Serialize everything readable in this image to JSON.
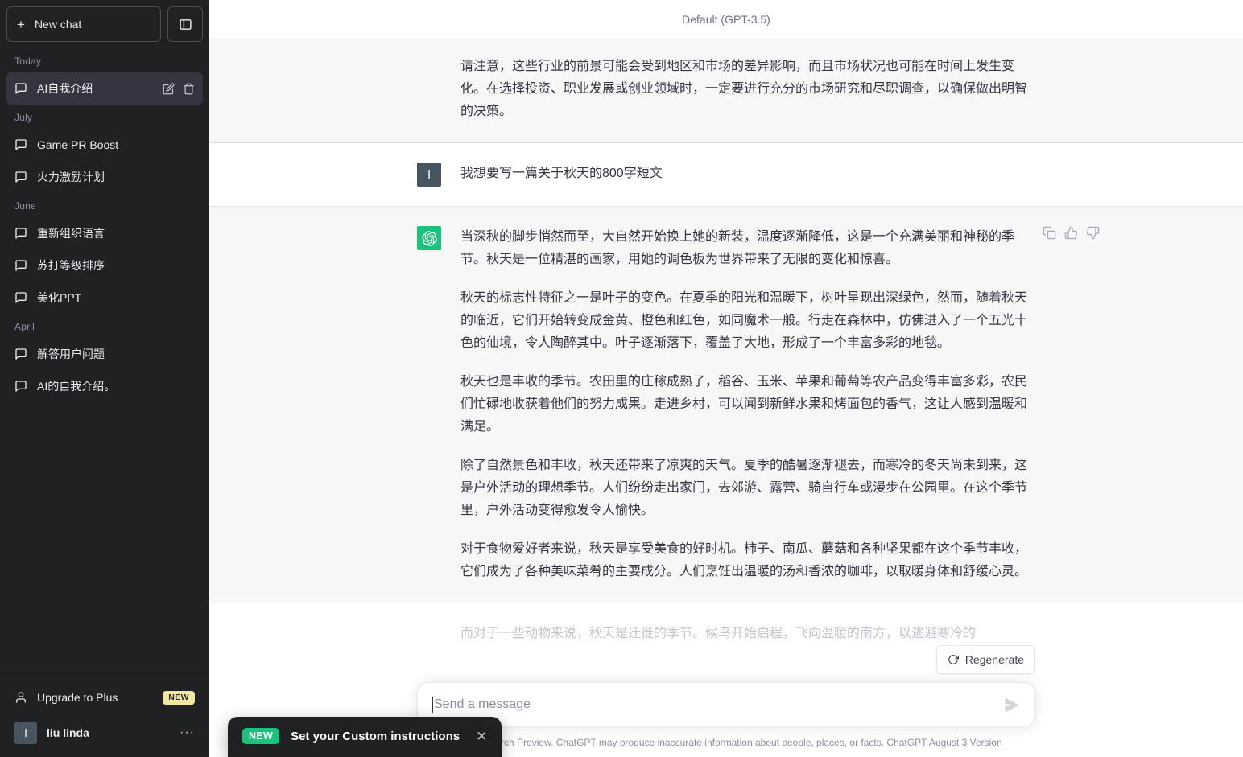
{
  "sidebar": {
    "new_chat_label": "New chat",
    "groups": [
      {
        "label": "Today",
        "items": [
          {
            "title": "AI自我介绍",
            "active": true
          }
        ]
      },
      {
        "label": "July",
        "items": [
          {
            "title": "Game PR Boost",
            "active": false
          },
          {
            "title": "火力激励计划",
            "active": false
          }
        ]
      },
      {
        "label": "June",
        "items": [
          {
            "title": "重新组织语言",
            "active": false
          },
          {
            "title": "苏打等级排序",
            "active": false
          },
          {
            "title": "美化PPT",
            "active": false
          }
        ]
      },
      {
        "label": "April",
        "items": [
          {
            "title": "解答用户问题",
            "active": false
          },
          {
            "title": "AI的自我介绍。",
            "active": false
          }
        ]
      }
    ],
    "upgrade_label": "Upgrade to Plus",
    "upgrade_badge": "NEW",
    "user_name": "liu linda",
    "user_initial": "l",
    "more_dots": "···"
  },
  "header": {
    "model": "Default (GPT-3.5)"
  },
  "messages": [
    {
      "role": "assistant",
      "paragraphs": [
        "请注意，这些行业的前景可能会受到地区和市场的差异影响，而且市场状况也可能在时间上发生变化。在选择投资、职业发展或创业领域时，一定要进行充分的市场研究和尽职调查，以确保做出明智的决策。"
      ]
    },
    {
      "role": "user",
      "avatar_initial": "l",
      "paragraphs": [
        "我想要写一篇关于秋天的800字短文"
      ]
    },
    {
      "role": "assistant",
      "paragraphs": [
        "当深秋的脚步悄然而至，大自然开始换上她的新装，温度逐渐降低，这是一个充满美丽和神秘的季节。秋天是一位精湛的画家，用她的调色板为世界带来了无限的变化和惊喜。",
        "秋天的标志性特征之一是叶子的变色。在夏季的阳光和温暖下，树叶呈现出深绿色，然而，随着秋天的临近，它们开始转变成金黄、橙色和红色，如同魔术一般。行走在森林中，仿佛进入了一个五光十色的仙境，令人陶醉其中。叶子逐渐落下，覆盖了大地，形成了一个丰富多彩的地毯。",
        "秋天也是丰收的季节。农田里的庄稼成熟了，稻谷、玉米、苹果和葡萄等农产品变得丰富多彩，农民们忙碌地收获着他们的努力成果。走进乡村，可以闻到新鲜水果和烤面包的香气，这让人感到温暖和满足。",
        "除了自然景色和丰收，秋天还带来了凉爽的天气。夏季的酷暑逐渐褪去，而寒冷的冬天尚未到来，这是户外活动的理想季节。人们纷纷走出家门，去郊游、露营、骑自行车或漫步在公园里。在这个季节里，户外活动变得愈发令人愉快。",
        "对于食物爱好者来说，秋天是享受美食的好时机。柿子、南瓜、蘑菇和各种坚果都在这个季节丰收，它们成为了各种美味菜肴的主要成分。人们烹饪出温暖的汤和香浓的咖啡，以取暖身体和舒缓心灵。"
      ],
      "actions": [
        "copy-icon",
        "thumbs-up-icon",
        "thumbs-down-icon"
      ]
    }
  ],
  "faded_continuation": "而对于一些动物来说，秋天是迁徙的季节。候鸟开始启程，飞向温暖的南方，以逃避寒冷的",
  "composer": {
    "placeholder": "Send a message",
    "value": "",
    "regenerate_label": "Regenerate"
  },
  "footer": {
    "disclaimer": "Free Research Preview. ChatGPT may produce inaccurate information about people, places, or facts.",
    "version_link": "ChatGPT August 3 Version"
  },
  "toast": {
    "badge": "NEW",
    "text": "Set your Custom instructions",
    "close": "✕"
  },
  "colors": {
    "sidebar_bg": "#202123",
    "accent_green": "#19c37d",
    "assistant_msg_bg": "#f7f7f8",
    "badge_yellow": "#f3e8a1",
    "user_avatar": "#47555e"
  }
}
